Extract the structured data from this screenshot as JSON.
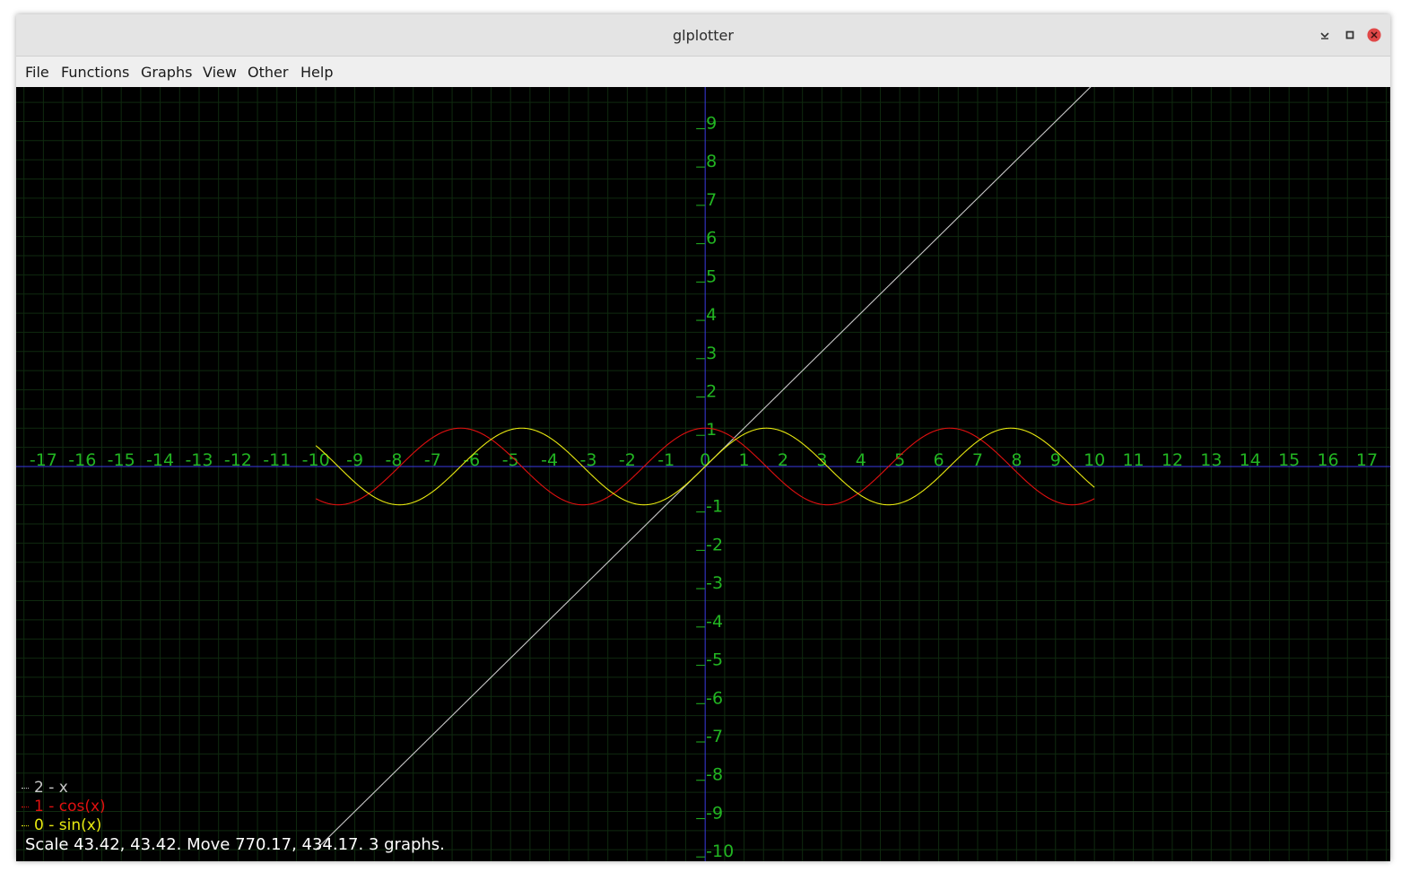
{
  "window": {
    "title": "glplotter"
  },
  "menu": {
    "items": [
      "File",
      "Functions",
      "Graphs",
      "View",
      "Other",
      "Help"
    ]
  },
  "plot": {
    "background": "#000000",
    "grid_color": "#0f2a0f",
    "axis_color": "#3a3ae0",
    "tick_label_color": "#22b522"
  },
  "chart_data": {
    "type": "line",
    "x_ticks": [
      "-17",
      "-16",
      "-15",
      "-14",
      "-13",
      "-12",
      "-11",
      "-10",
      "-9",
      "-8",
      "-7",
      "-6",
      "-5",
      "-4",
      "-3",
      "-2",
      "-1",
      "0",
      "1",
      "2",
      "3",
      "4",
      "5",
      "6",
      "7",
      "8",
      "9",
      "10",
      "11",
      "12",
      "13",
      "14",
      "15",
      "16",
      "17"
    ],
    "y_ticks": [
      "9",
      "8",
      "7",
      "6",
      "5",
      "4",
      "3",
      "2",
      "1",
      "-1",
      "-2",
      "-3",
      "-4",
      "-5",
      "-6",
      "-7",
      "-8",
      "-9",
      "-10"
    ],
    "xlim": [
      -17.7,
      17.6
    ],
    "ylim": [
      -10.3,
      9.9
    ],
    "grid": true,
    "series": [
      {
        "label": "2 - x",
        "expr": "x",
        "color": "#c8c8c8",
        "domain": [
          -10,
          10
        ]
      },
      {
        "label": "1 - cos(x)",
        "expr": "cos",
        "color": "#e01010",
        "domain": [
          -10,
          10
        ]
      },
      {
        "label": "0 - sin(x)",
        "expr": "sin",
        "color": "#e8e810",
        "domain": [
          -10,
          10
        ]
      }
    ]
  },
  "legend": {
    "placement": "bottom-left",
    "items": [
      {
        "text": "2 - x",
        "color": "#c8c8c8"
      },
      {
        "text": "1 - cos(x)",
        "color": "#e01010"
      },
      {
        "text": "0 - sin(x)",
        "color": "#e8e810"
      }
    ]
  },
  "status": {
    "text": "Scale 43.42, 43.42. Move 770.17, 434.17. 3 graphs."
  },
  "icons": {
    "minimize": "minimize-icon",
    "maximize": "maximize-icon",
    "close": "close-icon"
  },
  "colors": {
    "close_button": "#e04848"
  }
}
